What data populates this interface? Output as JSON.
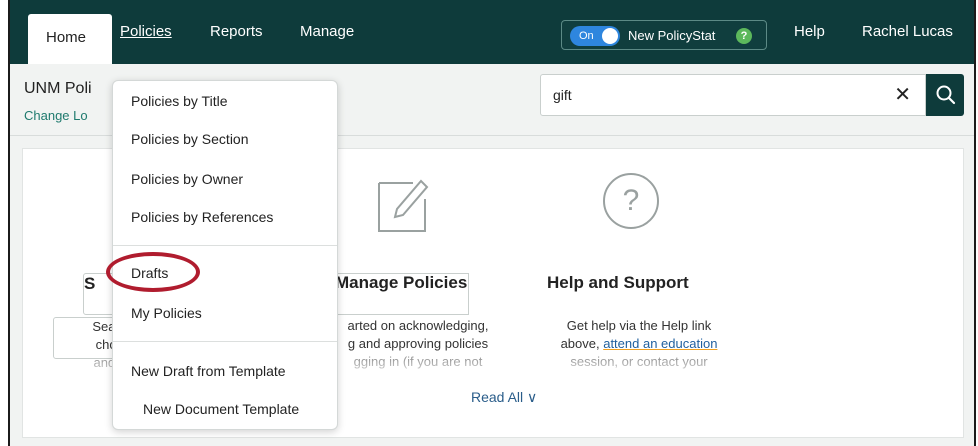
{
  "nav": {
    "tabs": [
      "Home",
      "Policies",
      "Reports",
      "Manage"
    ],
    "toggle_state": "On",
    "toggle_label": "New PolicyStat",
    "toggle_help": "?",
    "help": "Help",
    "user": "Rachel Lucas"
  },
  "header": {
    "site_name": "UNM Poli",
    "change_location": "Change Lo"
  },
  "search": {
    "value": "gift",
    "clear_glyph": "✕"
  },
  "features": {
    "search_title": "S",
    "search_lines": [
      "Search",
      "choos",
      "and se"
    ],
    "manage_title": "Manage Policies",
    "manage_lines": [
      "arted on acknowledging,",
      "g and approving policies",
      "gging in (if you are not"
    ],
    "help_title": "Help and Support",
    "help_lines": [
      "Get help via the Help link",
      "above, ",
      "attend an education",
      "session, or contact your"
    ],
    "help_q": "?",
    "read_all": "Read All ∨"
  },
  "menu": {
    "items": [
      "Policies by Title",
      "Policies by Section",
      "Policies by Owner",
      "Policies by References",
      "Drafts",
      "My Policies",
      "New Draft from Template",
      "New Document Template"
    ]
  },
  "colors": {
    "nav_bg": "#0e3b3b",
    "accent_link": "#1f7a6e",
    "highlight_ring": "#b01c2e",
    "toggle_blue": "#2e86de"
  }
}
